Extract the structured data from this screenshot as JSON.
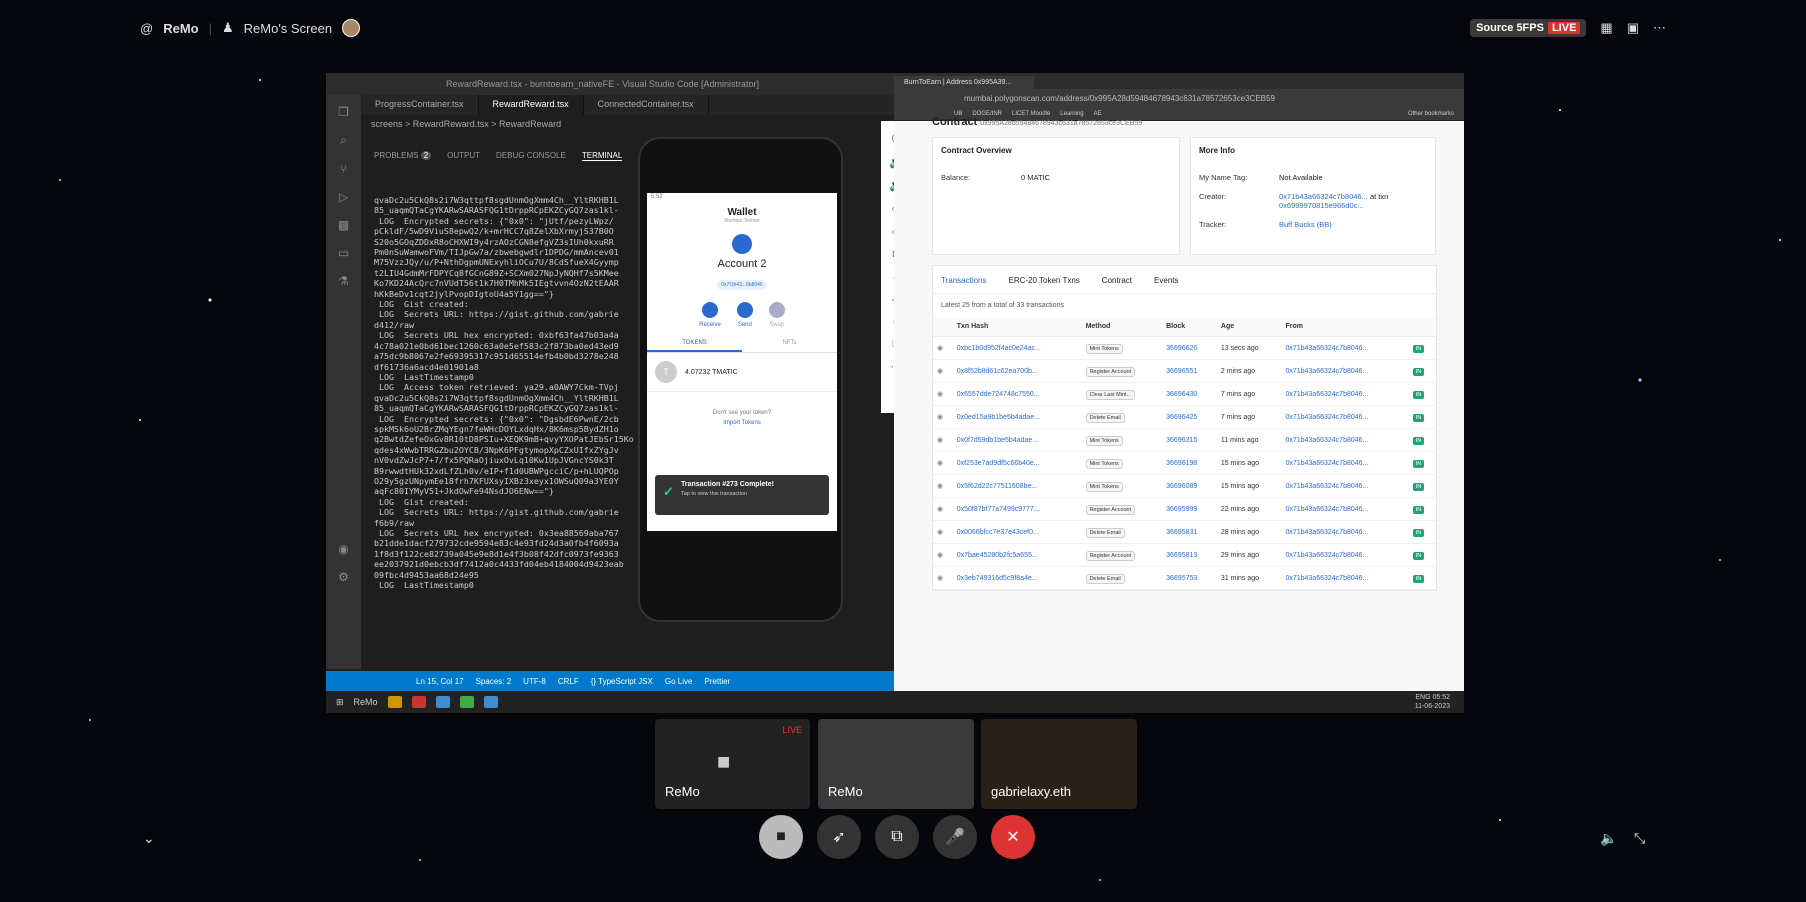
{
  "topbar": {
    "app": "ReMo",
    "screen_owner": "ReMo's Screen",
    "source": "Source 5FPS",
    "live": "LIVE"
  },
  "vscode": {
    "title": "RewardReward.tsx - burntoearn_nativeFE - Visual Studio Code [Administrator]",
    "tabs": [
      "ProgressContainer.tsx",
      "RewardReward.tsx",
      "ConnectedContainer.tsx"
    ],
    "breadcrumb": "screens > RewardReward.tsx > RewardReward",
    "panel_tabs": [
      "PROBLEMS",
      "OUTPUT",
      "DEBUG CONSOLE",
      "TERMINAL"
    ],
    "problems_count": "2",
    "terminal": "qvaDc2u5CkQ8s2i7W3qttpf8sgdUnmOgXmm4Ch__YltRKHB1L\n85_uaqmQTaCgYKARwSARASFQG1tDrppRCpEKZCyGQ7zas1kl-\n LOG  Encrypted secrets: {\"0x0\": \"jUtf/pezyLWpz/\npCkldF/5wD9ViuS8epwQ2/k+mrHCC7q8ZelXbXrmyjS37B0O\nS20o5GOqZDDxR8oCHXWI9y4rzAOzCGN8efgVZ3sIUh0kxuRR\nPm0nSuWamwoFVm/TIJpGw7a/zbwebgwdlr1DPDG/mmAncev01\nM75VzzJQy/u/P+NthDgpmUNExyhliOCu7U/8CdSfueX4Gyymp\nt2LIU4GdmMrFDPYCq8fGCnG89Z+SCXm027NpJyNQHf7s5KMee\nKo7KD24AcQrc7nVUdT56t1k7H0TMhMk5IEgtvvn4OzN2tEAAR\nhKkBeDv1cqt2jylPvopDIgtoU4a5Y1gg==\"}\n LOG  Gist created:\n LOG  Secrets URL: https://gist.github.com/gabrie\nd412/raw\n LOG  Secrets URL hex encrypted: 0xbf63fa47b03a4a\n4c78a021e0bd61bec1260c63a0e5ef583c2f873ba0ed43ed9\na75dc9b8067e2fe69395317c951d65514efb4b0bd3278e248\ndf61736a6acd4e01901a8\n LOG  LastTimestamp0\n LOG  Access token retrieved: ya29.a0AWY7Ckm-TVpj\nqvaDc2u5CkQ8s2i7W3qttpf8sgdUnmOgXmm4Ch__YltRKHB1L\n85_uaqmQTaCgYKARwSARASFQG1tDrppRCpEKZCyGQ7zas1kl-\n LOG  Encrypted secrets: {\"0x0\": \"DgsbdE6PwnE/2cb\nspkMSk6oU2BrZMqYEgn7feWHcDOYLxdqHx/8K6msp5BydZH1o\nq2BwtdZefeOxGv8R10tD8PSIu+XEQK9mB+qvyYXOPatJEbSr15Ko\nqdes4xWwbTRRGZbu2OYCB/3NpK6PFgtymopXpCZxUIfxZYgJv\nnV0vdZwJcP7+7/fx5PQRaOjiuxOvLq10Kw1UpJVGncYS0k3T\nB9rwwdtHUk32xdLfZLh0v/eIP+f1d0UBWPgcciC/p+hLUQPOp\nO29y5gzUNpymEe18frh7KFUXsyIXBz3xeyx1OWSuQ09a3YE0Y\naqFc80IYMyV51+JkdOwFe94NsdJO6ENw==\"}\n LOG  Gist created:\n LOG  Secrets URL: https://gist.github.com/gabrie\nf6b9/raw\n LOG  Secrets URL hex encrypted: 0x3ea88569aba767\nb21dde1dacf279732cde9594e83c4e93fd24d3a0fb4f6093a\n1f8d3f122ce82739a045e9e8d1e4f3b08f42dfc0973fe9363\nee2037921d0ebcb3df7412a0c4433fd04eb4184004d9423eab\n09fbc4d9453aa68d24e95\n LOG  LastTimestamp0",
    "status": [
      "Ln 15, Col 17",
      "Spaces: 2",
      "UTF-8",
      "CRLF",
      "{} TypeScript JSX",
      "Go Live",
      "Prettier"
    ]
  },
  "phone": {
    "time": "5:52",
    "wallet_title": "Wallet",
    "network": "Mumbai Testnet",
    "account": "Account 2",
    "address": "0x7f1b43...6b8046",
    "actions": [
      "Receive",
      "Send",
      "Swap"
    ],
    "tabs": [
      "TOKENS",
      "NFTs"
    ],
    "token_letter": "T",
    "token_balance": "4.07232 TMATIC",
    "help": "Don't see your token?",
    "import": "Import Tokens",
    "toast_title": "Transaction #273 Complete!",
    "toast_sub": "Tap to view this transaction"
  },
  "browser": {
    "tab": "BurnToEarn | Address 0x995A39...",
    "url": "mumbai.polygonscan.com/address/0x995A28d59484678943c631a78572653ce3CEB59",
    "bookmarks": [
      "UB",
      "DOGE/INR",
      "LICET Moodle",
      "Learning",
      "AE",
      "Other bookmarks"
    ],
    "contract_label": "Contract",
    "contract_addr": "0x995A28d59484678943c631a78572653ce3CEB59",
    "overview_title": "Contract Overview",
    "balance_k": "Balance:",
    "balance_v": "0 MATIC",
    "more_title": "More Info",
    "nametag_k": "My Name Tag:",
    "nametag_v": "Not Available",
    "creator_k": "Creator:",
    "creator_v": "0x71b43a66324c7b8046...",
    "creator_at": "at txn",
    "creator_tx": "0x6999970815e966d0c...",
    "tracker_k": "Tracker:",
    "tracker_v": "Buff Bucks (BB)",
    "tx_tabs": [
      "Transactions",
      "ERC-20 Token Txns",
      "Contract",
      "Events"
    ],
    "tx_note": "Latest 25 from a total of 33 transactions",
    "columns": [
      "Txn Hash",
      "Method",
      "Block",
      "Age",
      "From"
    ],
    "rows": [
      [
        "0xbc1b0d952f4ac0e24ac...",
        "Mint Tokens",
        "36696626",
        "13 secs ago",
        "0x71b43a66324c7b8046..."
      ],
      [
        "0x8f52b8d61c62ea700b...",
        "Register Account",
        "36696551",
        "2 mins ago",
        "0x71b43a66324c7b8046..."
      ],
      [
        "0x6557dde724748c7550...",
        "Clear Last Mint...",
        "36696430",
        "7 mins ago",
        "0x71b43a66324c7b8046..."
      ],
      [
        "0x0ed15a9b1be5b4adae...",
        "Delete Email",
        "36696425",
        "7 mins ago",
        "0x71b43a66324c7b8046..."
      ],
      [
        "0x0f7d59db1be5b4adae...",
        "Mint Tokens",
        "36696315",
        "11 mins ago",
        "0x71b43a66324c7b8046..."
      ],
      [
        "0xf253e7ad9df5c66b40e...",
        "Mint Tokens",
        "36696198",
        "15 mins ago",
        "0x71b43a66324c7b8046..."
      ],
      [
        "0x5f62d22c77511608be...",
        "Mint Tokens",
        "36696089",
        "15 mins ago",
        "0x71b43a66324c7b8046..."
      ],
      [
        "0x50f87bf77a7499c9777...",
        "Register Account",
        "36695999",
        "22 mins ago",
        "0x71b43a66324c7b8046..."
      ],
      [
        "0x0066bfcc7e37e43cef0...",
        "Delete Email",
        "36695831",
        "28 mins ago",
        "0x71b43a66324c7b8046..."
      ],
      [
        "0x7bae45280b2fc5a655...",
        "Register Account",
        "36695813",
        "29 mins ago",
        "0x71b43a66324c7b8046..."
      ],
      [
        "0x3eb749316d5c9f8a4e...",
        "Delete Email",
        "36695753",
        "31 mins ago",
        "0x71b43a66324c7b8046..."
      ]
    ],
    "in_label": "IN"
  },
  "taskbar": {
    "app": "ReMo",
    "lang": "ENG",
    "time": "05:52",
    "date": "11-06-2023"
  },
  "tiles": {
    "t1": "ReMo",
    "t1_live": "LIVE",
    "t2": "ReMo",
    "t3": "gabrielaxy.eth"
  }
}
